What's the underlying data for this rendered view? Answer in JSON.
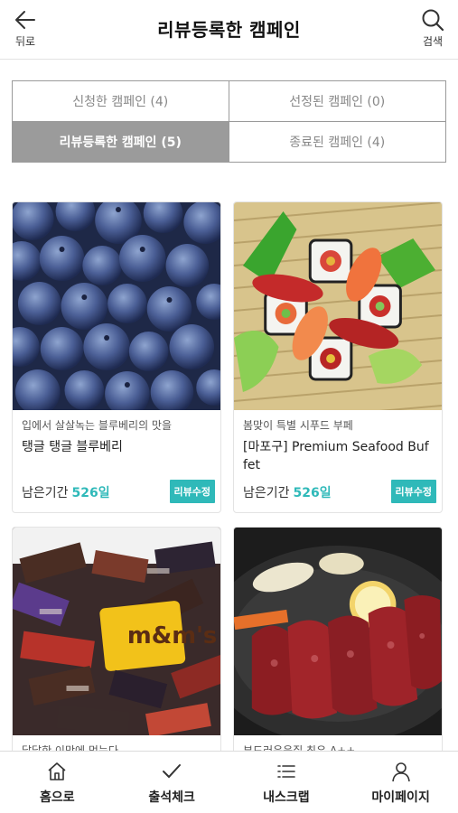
{
  "header": {
    "back_label": "뒤로",
    "title": "리뷰등록한 캠페인",
    "search_label": "검색"
  },
  "tabs": [
    {
      "label": "신청한 캠페인 (4)",
      "active": false
    },
    {
      "label": "선정된 캠페인 (0)",
      "active": false
    },
    {
      "label": "리뷰등록한 캠페인 (5)",
      "active": true
    },
    {
      "label": "종료된 캠페인 (4)",
      "active": false
    }
  ],
  "cards": [
    {
      "subtitle": "입에서 살살녹는 블루베리의 맛을",
      "title": "탱글 탱글 블루베리",
      "remain_label": "남은기간",
      "remain_days": "526일",
      "button": "리뷰수정",
      "image": "blueberries"
    },
    {
      "subtitle": "봄맞이 특별 시푸드 부페",
      "title": "[마포구] Premium Seafood Buffet",
      "remain_label": "남은기간",
      "remain_days": "526일",
      "button": "리뷰수정",
      "image": "sushi"
    },
    {
      "subtitle": "달달한 이맛에 먹는다",
      "title": "",
      "image": "chocolates"
    },
    {
      "subtitle": "부드러운육질 최우 A++",
      "title": "",
      "image": "steak"
    }
  ],
  "bottom_nav": [
    {
      "label": "홈으로",
      "icon": "home-icon"
    },
    {
      "label": "출석체크",
      "icon": "check-icon"
    },
    {
      "label": "내스크랩",
      "icon": "list-icon"
    },
    {
      "label": "마이페이지",
      "icon": "user-icon"
    }
  ],
  "colors": {
    "accent": "#2fb9b9",
    "tab_active": "#9b9b9b"
  }
}
